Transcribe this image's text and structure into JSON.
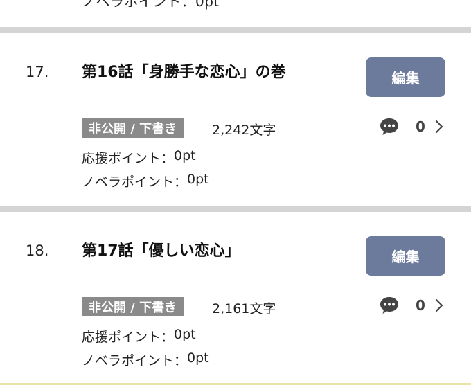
{
  "top_partial": {
    "text": "ノベラポイント：0pt"
  },
  "episodes": [
    {
      "number": "17.",
      "title": "第16話「身勝手な恋心」の巻",
      "edit_label": "編集",
      "status": "非公開 / 下書き",
      "char_count": "2,242文字",
      "comment_count": "0",
      "support_label": "応援ポイント：",
      "support_value": "0pt",
      "novela_label": "ノベラポイント：",
      "novela_value": "0pt"
    },
    {
      "number": "18.",
      "title": "第17話「優しい恋心」",
      "edit_label": "編集",
      "status": "非公開 / 下書き",
      "char_count": "2,161文字",
      "comment_count": "0",
      "support_label": "応援ポイント：",
      "support_value": "0pt",
      "novela_label": "ノベラポイント：",
      "novela_value": "0pt"
    }
  ],
  "icons": {
    "comment": "speech-bubble-icon",
    "chevron": "chevron-right-icon"
  },
  "colors": {
    "edit_button": "#6c7a9c",
    "status_badge": "#8a8a8a",
    "divider": "#d4d4d4",
    "accent_bottom": "#e9e4a6"
  }
}
